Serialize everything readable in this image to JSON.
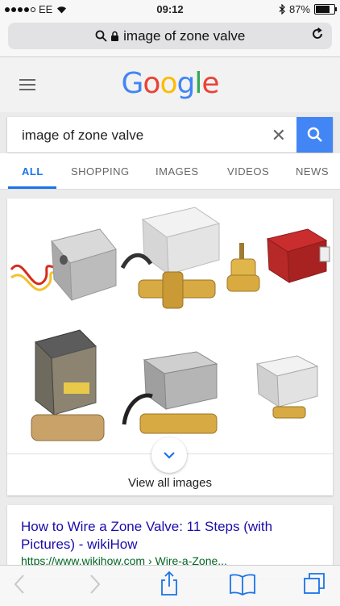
{
  "status_bar": {
    "carrier": "EE",
    "time": "09:12",
    "battery": "87%",
    "battery_level": 0.87
  },
  "url_bar": {
    "query": "image of zone valve"
  },
  "google": {
    "logo": "Google",
    "logo_colors": [
      "#4285f4",
      "#ea4335",
      "#fbbc05",
      "#4285f4",
      "#34a853",
      "#ea4335"
    ]
  },
  "search": {
    "value": "image of zone valve",
    "accent": "#4285f4"
  },
  "tabs": [
    {
      "label": "ALL",
      "active": true
    },
    {
      "label": "SHOPPING",
      "active": false
    },
    {
      "label": "IMAGES",
      "active": false
    },
    {
      "label": "VIDEOS",
      "active": false
    },
    {
      "label": "NEWS",
      "active": false
    }
  ],
  "images": {
    "view_all": "View all images",
    "thumbnails": [
      "zone-valve-actuator-red-yellow-wires",
      "white-zone-valve-brass-body",
      "small-brass-valve",
      "red-actuator-valve",
      "tan-actuator-brass-valve",
      "grey-actuator-two-port-valve",
      "small-white-actuator-valve"
    ]
  },
  "result": {
    "title": "How to Wire a Zone Valve: 11 Steps (with Pictures) - wikiHow",
    "url": "https://www.wikihow.com › Wire-a-Zone..."
  },
  "toolbar": [
    "back-icon",
    "forward-icon",
    "share-icon",
    "bookmarks-icon",
    "tabs-icon"
  ]
}
